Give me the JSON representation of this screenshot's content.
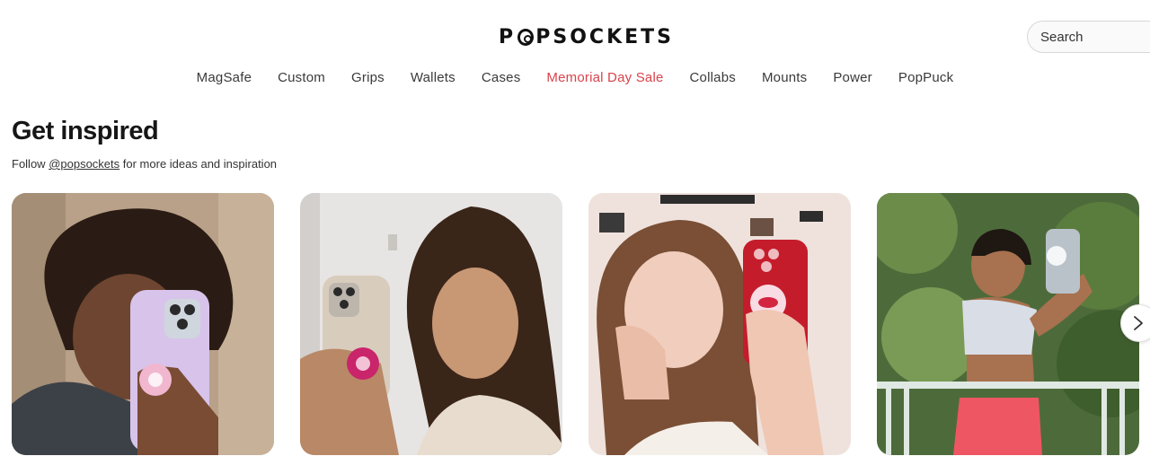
{
  "header": {
    "logo_text": "POPSOCKETS",
    "search": {
      "placeholder": "Search"
    }
  },
  "nav": {
    "items": [
      {
        "label": "MagSafe"
      },
      {
        "label": "Custom"
      },
      {
        "label": "Grips"
      },
      {
        "label": "Wallets"
      },
      {
        "label": "Cases"
      },
      {
        "label": "Memorial Day Sale",
        "color": "#d9434b"
      },
      {
        "label": "Collabs"
      },
      {
        "label": "Mounts"
      },
      {
        "label": "Power"
      },
      {
        "label": "PopPuck"
      }
    ]
  },
  "inspired": {
    "title": "Get inspired",
    "follow_prefix": "Follow ",
    "handle": "@popsockets",
    "follow_suffix": " for more ideas and inspiration"
  },
  "colors": {
    "accent_sale": "#d9434b",
    "text": "#1a1a1a"
  },
  "icons": {
    "carousel_next": "chevron-right-icon"
  }
}
